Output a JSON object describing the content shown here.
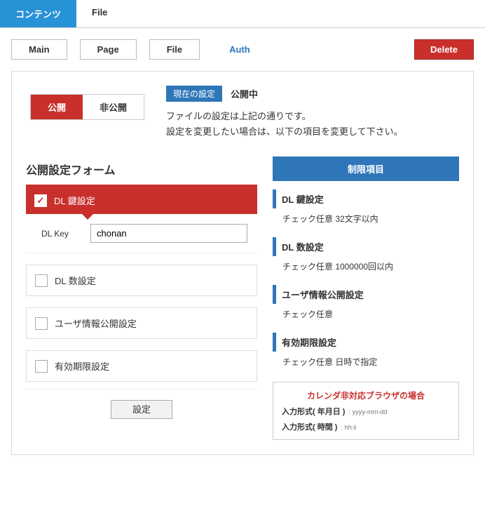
{
  "top_tabs": {
    "active": "コンテンツ",
    "inactive": "File"
  },
  "toolbar": {
    "main": "Main",
    "page": "Page",
    "file": "File",
    "auth": "Auth",
    "delete": "Delete"
  },
  "publish_toggle": {
    "public": "公開",
    "private": "非公開"
  },
  "status": {
    "badge": "現在の設定",
    "value": "公開中",
    "desc1": "ファイルの設定は上記の通りです。",
    "desc2": "設定を変更したい場合は、以下の項目を変更して下さい。"
  },
  "form": {
    "title": "公開設定フォーム",
    "dl_key": {
      "label": "DL 鍵設定",
      "field_label": "DL Key",
      "value": "chonan"
    },
    "dl_count": {
      "label": "DL 数設定"
    },
    "user_info": {
      "label": "ユーザ情報公開設定"
    },
    "expiry": {
      "label": "有効期限設定"
    },
    "submit": "設定"
  },
  "info": {
    "header": "制限項目",
    "dl_key": {
      "title": "DL 鍵設定",
      "body": "チェック任意 32文字以内"
    },
    "dl_count": {
      "title": "DL 数設定",
      "body": "チェック任意 1000000回以内"
    },
    "user_info": {
      "title": "ユーザ情報公開設定",
      "body": "チェック任意"
    },
    "expiry": {
      "title": "有効期限設定",
      "body": "チェック任意 日時で指定"
    },
    "calendar": {
      "warn": "カレンダ非対応ブラウザの場合",
      "date_label": "入力形式( 年月日 )",
      "date_fmt": ": yyyy-mm-dd",
      "time_label": "入力形式( 時間 )",
      "time_fmt": ": hh:ii"
    }
  }
}
